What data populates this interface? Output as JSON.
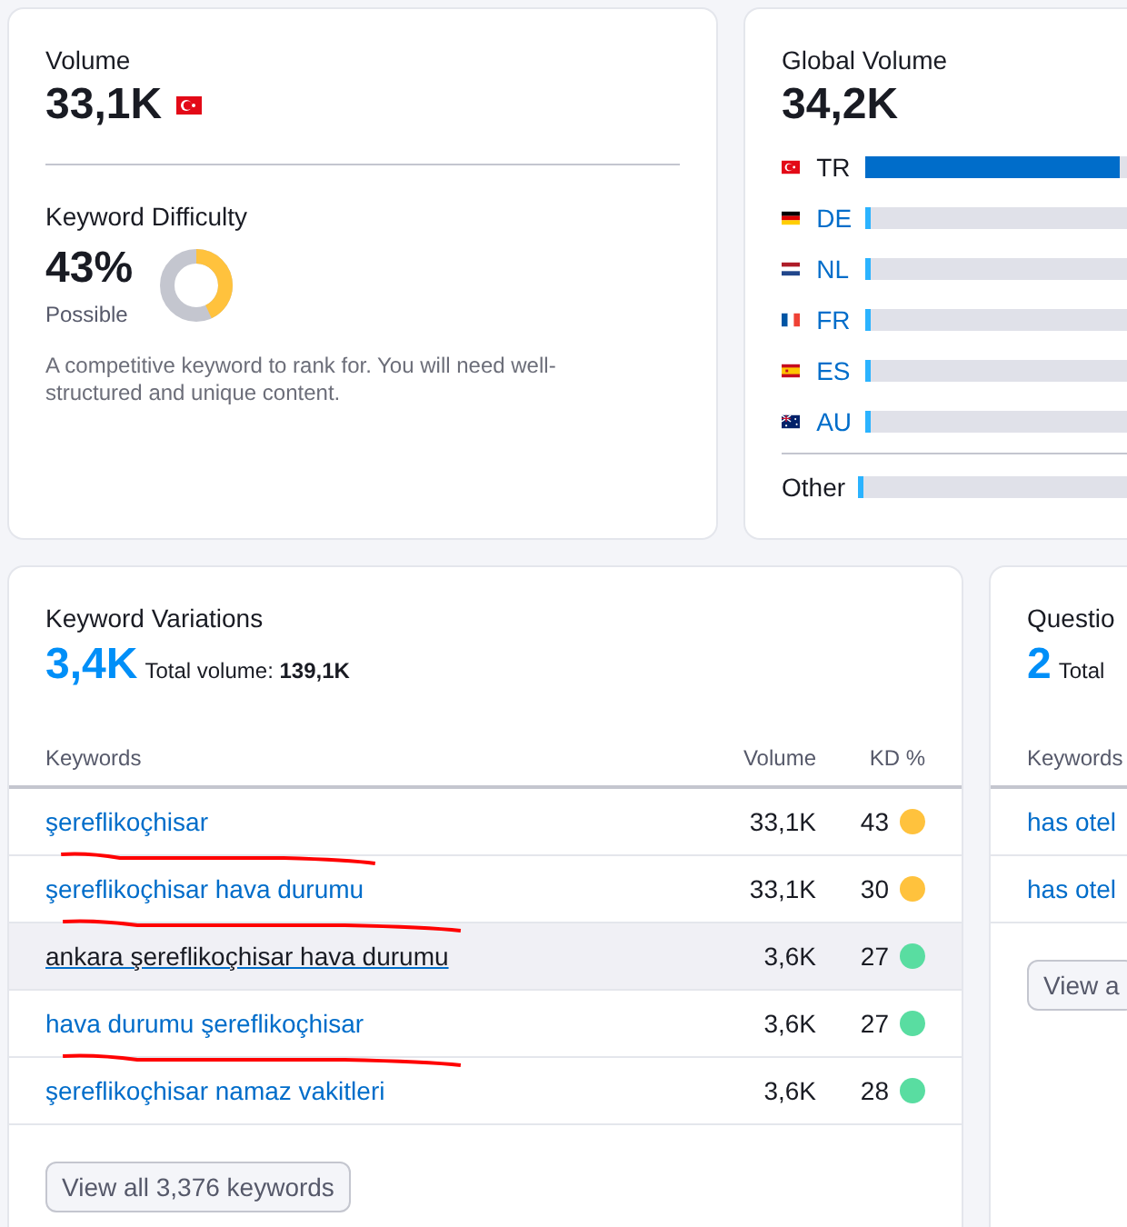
{
  "volume": {
    "label": "Volume",
    "value": "33,1K",
    "difficulty_label": "Keyword Difficulty",
    "difficulty_value": "43%",
    "difficulty_text": "Possible",
    "level": 0.43,
    "description": "A competitive keyword to rank for. You will need well-structured and unique content."
  },
  "global_volume": {
    "label": "Global Volume",
    "value": "34,2K",
    "countries": [
      {
        "code": "TR",
        "kind": "tr",
        "level": 0.97,
        "selected": true
      },
      {
        "code": "DE",
        "kind": "de",
        "level": 0.02,
        "selected": false
      },
      {
        "code": "NL",
        "kind": "nl",
        "level": 0.02,
        "selected": false
      },
      {
        "code": "FR",
        "kind": "fr",
        "level": 0.02,
        "selected": false
      },
      {
        "code": "ES",
        "kind": "es",
        "level": 0.02,
        "selected": false
      },
      {
        "code": "AU",
        "kind": "au",
        "level": 0.02,
        "selected": false
      }
    ],
    "other": {
      "label": "Other",
      "level": 0.02
    }
  },
  "keyword_variations": {
    "title": "Keyword Variations",
    "count": "3,4K",
    "total_label": "Total volume:",
    "total_value": "139,1K",
    "columns": [
      "Keywords",
      "Volume",
      "KD %"
    ],
    "rows": [
      {
        "keyword": "şereflikoçhisar",
        "volume": "33,1K",
        "kd": "43",
        "color": "#ffc23d",
        "highlighted": false,
        "marked": true
      },
      {
        "keyword": "şereflikoçhisar hava durumu",
        "volume": "33,1K",
        "kd": "30",
        "color": "#ffc23d",
        "highlighted": false,
        "marked": true
      },
      {
        "keyword": "ankara şereflikoçhisar hava durumu",
        "volume": "3,6K",
        "kd": "27",
        "color": "#59dda1",
        "highlighted": true,
        "marked": false
      },
      {
        "keyword": "hava durumu şereflikoçhisar",
        "volume": "3,6K",
        "kd": "27",
        "color": "#59dda1",
        "highlighted": false,
        "marked": true
      },
      {
        "keyword": "şereflikoçhisar namaz vakitleri",
        "volume": "3,6K",
        "kd": "28",
        "color": "#59dda1",
        "highlighted": false,
        "marked": false
      }
    ],
    "button": "View all 3,376 keywords"
  },
  "questions": {
    "title": "Questio",
    "count": "2",
    "total_label": "Total",
    "column": "Keywords",
    "rows": [
      "has otel",
      "has otel"
    ],
    "button": "View a"
  }
}
